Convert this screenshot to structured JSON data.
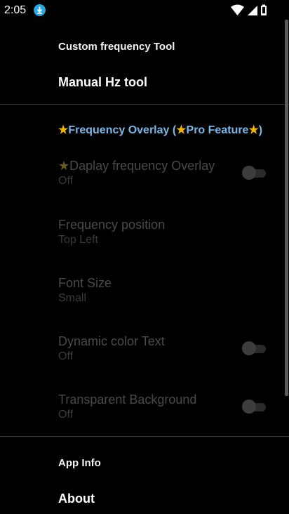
{
  "status_bar": {
    "time": "2:05",
    "icons": [
      "download-icon",
      "wifi-icon",
      "signal-icon",
      "battery-icon"
    ]
  },
  "general": {
    "category_title": "Custom frequency Tool",
    "manual_tool_title": "Manual Hz tool"
  },
  "overlay": {
    "category_title_prefix_star": "★",
    "category_title_main": "Frequency Overlay (",
    "category_title_star2": "★",
    "category_title_pro": "Pro Feature",
    "category_title_star3": "★",
    "category_title_end": ")",
    "items": [
      {
        "title_star": "★",
        "title": "Daplay frequency Overlay",
        "summary": "Off",
        "toggle": false
      },
      {
        "title": "Frequency position",
        "summary": "Top Left"
      },
      {
        "title": "Font Size",
        "summary": "Small"
      },
      {
        "title": "Dynamic color Text",
        "summary": "Off",
        "toggle": false
      },
      {
        "title": "Transparent Background",
        "summary": "Off",
        "toggle": false
      }
    ]
  },
  "info": {
    "category_title": "App Info",
    "about_title": "About"
  },
  "colors": {
    "background": "#000000",
    "accent_category": "#7ab6e6",
    "star": "#f1b400",
    "disabled_text": "#4a4a4a"
  }
}
